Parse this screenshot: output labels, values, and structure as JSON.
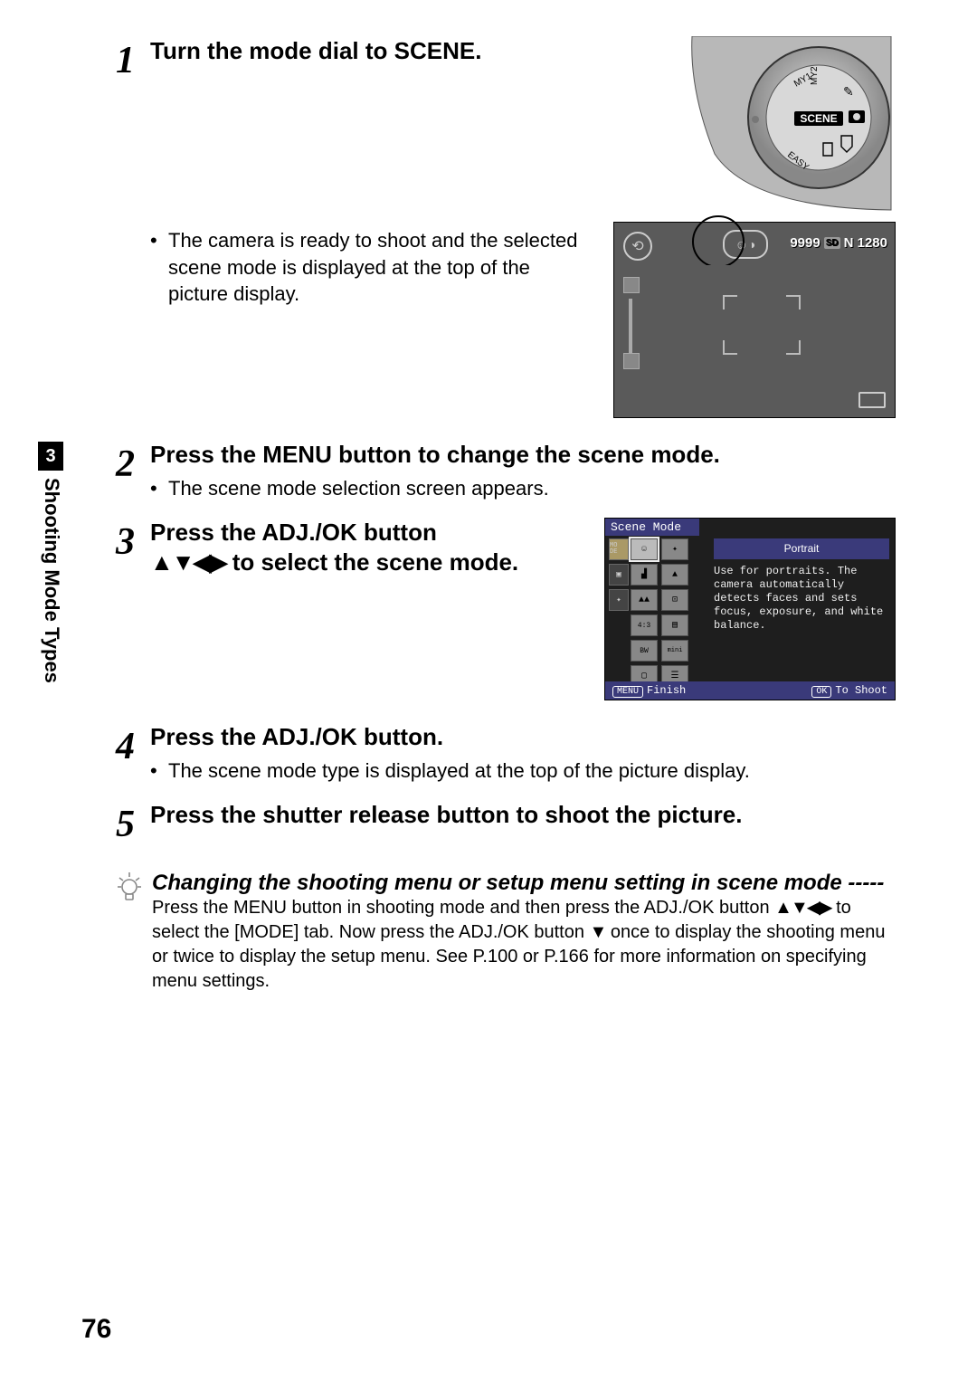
{
  "sidebar": {
    "chapter_number": "3",
    "chapter_title": "Shooting Mode Types"
  },
  "page_number": "76",
  "steps": [
    {
      "num": "1",
      "title": "Turn the mode dial to SCENE.",
      "bullet": "The camera is ready to shoot and the selected scene mode is displayed at the top of the picture display."
    },
    {
      "num": "2",
      "title": "Press the MENU button to change the scene mode.",
      "bullet": "The scene mode selection screen appears."
    },
    {
      "num": "3",
      "title_a": "Press the ADJ./OK button",
      "title_b": "to select the scene mode.",
      "arrows": "▲▼◀▶"
    },
    {
      "num": "4",
      "title": "Press the ADJ./OK button.",
      "bullet": "The scene mode type is displayed at the top of the picture display."
    },
    {
      "num": "5",
      "title": "Press the shutter release button to shoot the picture."
    }
  ],
  "note": {
    "title": "Changing the shooting menu or setup menu setting in scene mode -----",
    "body_a": "Press the MENU button in shooting mode and then press the ADJ./OK button ",
    "arrows": "▲▼◀▶",
    "body_b": " to select the [MODE] tab. Now press the ADJ./OK button ",
    "arrow_down": "▼",
    "body_c": " once to display the shooting menu or twice to display the setup menu. See P.100 or P.166 for more information on specifying menu settings."
  },
  "dial": {
    "label": "SCENE",
    "modes": [
      "MY1",
      "MY2",
      "EASY"
    ]
  },
  "lcd1": {
    "shots": "9999",
    "card": "SD",
    "size": "N 1280"
  },
  "lcd2": {
    "header": "Scene Mode",
    "tab1": "MO DE",
    "selected_name": "Portrait",
    "desc": "Use for portraits. The camera automatically detects faces and sets focus, exposure, and white balance.",
    "grid_labels": [
      "mini"
    ],
    "foot_left_btn": "MENU",
    "foot_left": "Finish",
    "foot_right_btn": "OK",
    "foot_right": "To Shoot"
  }
}
